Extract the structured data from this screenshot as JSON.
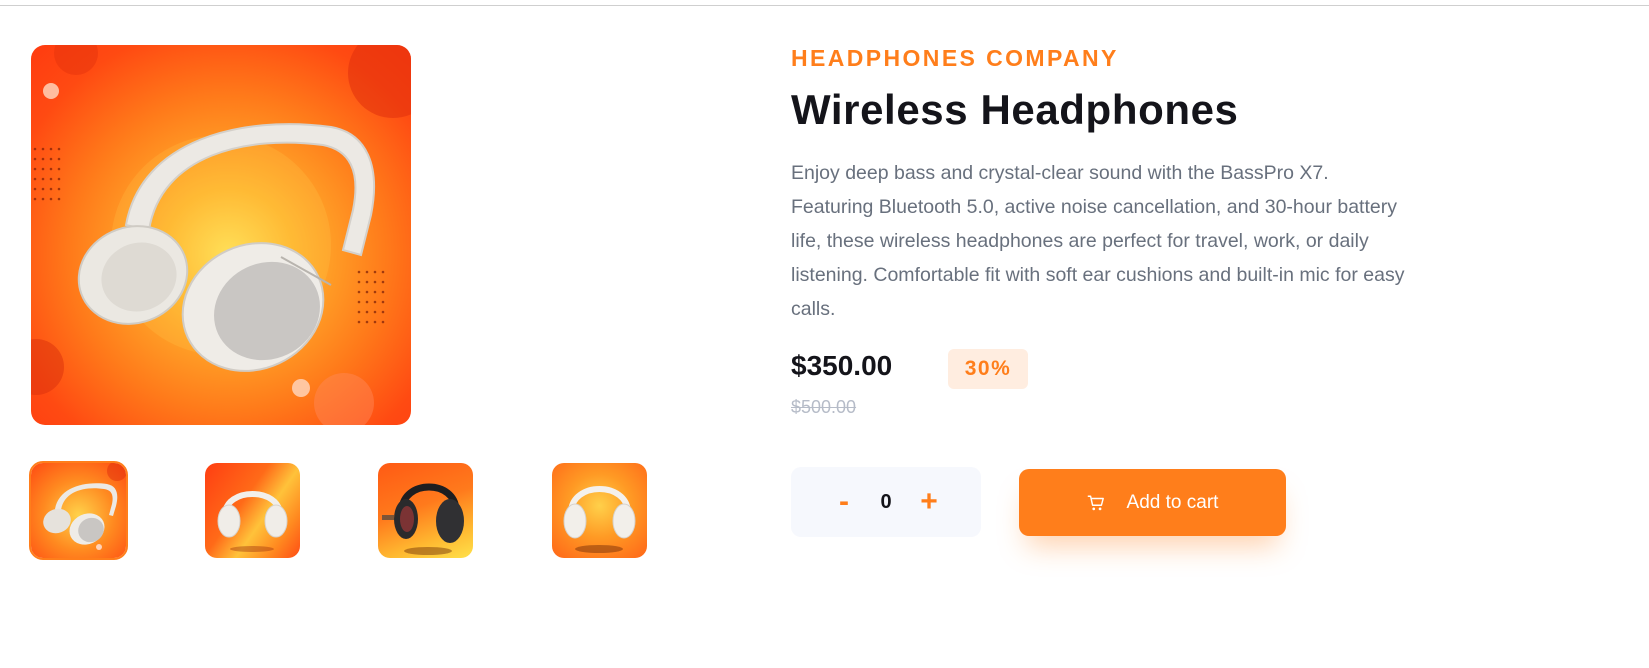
{
  "product": {
    "company": "HEADPHONES COMPANY",
    "title": "Wireless Headphones",
    "description": "Enjoy deep bass and crystal-clear sound with the BassPro X7. Featuring Bluetooth 5.0, active noise cancellation, and 30-hour battery life, these wireless headphones are perfect for travel, work, or daily listening. Comfortable fit with soft ear cushions and built-in mic for easy calls.",
    "price": "$350.00",
    "discount": "30%",
    "old_price": "$500.00"
  },
  "quantity": {
    "minus_label": "-",
    "value": "0",
    "plus_label": "+"
  },
  "cart": {
    "label": "Add to cart",
    "icon": "cart-icon"
  },
  "gallery": {
    "main_image": "white-headphones-product-photo",
    "thumbnails": [
      {
        "image": "white-headphones-side-view",
        "selected": true
      },
      {
        "image": "white-headphones-front-view",
        "selected": false
      },
      {
        "image": "black-headphones-view",
        "selected": false
      },
      {
        "image": "white-headphones-front-view-alt",
        "selected": false
      }
    ]
  },
  "colors": {
    "accent": "#ff7e1b",
    "accent_light": "#ffede0",
    "text_dark": "#14141a",
    "text_muted": "#68707d",
    "old_price": "#b6bcc8"
  }
}
